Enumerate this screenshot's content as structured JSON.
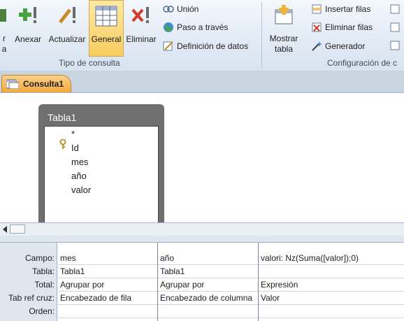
{
  "ribbon": {
    "buttons": [
      {
        "label": "r\na",
        "icon": "run-icon"
      },
      {
        "label": "Anexar",
        "icon": "append-plus-icon"
      },
      {
        "label": "Actualizar",
        "icon": "update-pencil-icon"
      },
      {
        "label": "General",
        "icon": "crosstab-grid-icon"
      },
      {
        "label": "Eliminar",
        "icon": "delete-x-icon"
      }
    ],
    "small_buttons": [
      {
        "label": "Unión",
        "icon": "union-rings-icon"
      },
      {
        "label": "Paso a través",
        "icon": "globe-icon"
      },
      {
        "label": "Definición de datos",
        "icon": "data-definition-icon"
      }
    ],
    "group1_label": "Tipo de consulta",
    "show_table": "Mostrar\ntabla",
    "setup_buttons": [
      {
        "label": "Insertar filas",
        "icon": "insert-rows-icon"
      },
      {
        "label": "Eliminar filas",
        "icon": "delete-rows-icon"
      },
      {
        "label": "Generador",
        "icon": "builder-wand-icon"
      }
    ],
    "group2_label": "Configuración de c"
  },
  "tab": {
    "label": "Consulta1"
  },
  "table": {
    "title": "Tabla1",
    "fields": [
      "*",
      "Id",
      "mes",
      "año",
      "valor"
    ]
  },
  "grid": {
    "row_labels": [
      "Campo:",
      "Tabla:",
      "Total:",
      "Tab ref cruz:",
      "Orden:"
    ],
    "columns": [
      {
        "campo": "mes",
        "tabla": "Tabla1",
        "total": "Agrupar por",
        "tabref": "Encabezado de fila",
        "orden": ""
      },
      {
        "campo": "año",
        "tabla": "Tabla1",
        "total": "Agrupar por",
        "tabref": "Encabezado de columna",
        "orden": ""
      },
      {
        "campo": "valori: Nz(Suma([valor]);0)",
        "tabla": "",
        "total": "Expresión",
        "tabref": "Valor",
        "orden": ""
      }
    ]
  }
}
